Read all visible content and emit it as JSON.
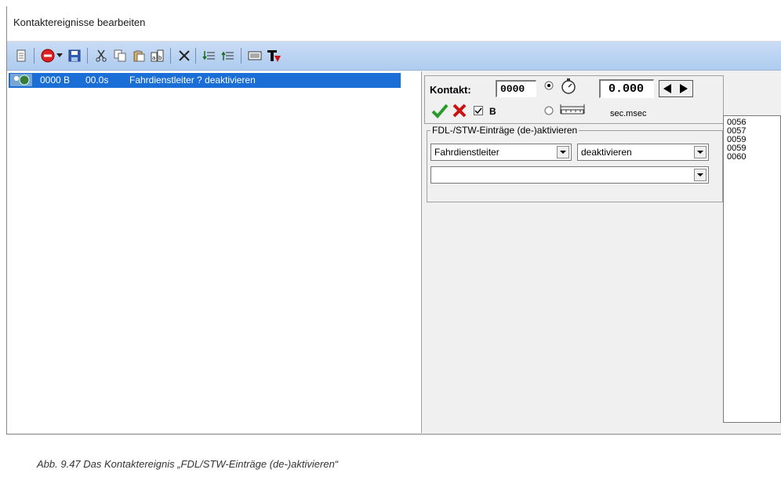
{
  "window": {
    "title": "Kontaktereignisse bearbeiten"
  },
  "toolbar": {
    "icons": [
      "new-document-icon",
      "record-icon",
      "dropdown-arrow-icon",
      "save-icon",
      "cut-icon",
      "copy-icon",
      "paste-icon",
      "paste-special-icon",
      "delete-icon",
      "move-down-icon",
      "move-up-icon",
      "list-view-icon",
      "text-tool-icon"
    ]
  },
  "events": [
    {
      "icon": "contact-event-icon",
      "contact": "0000 B",
      "time": "00.0s",
      "description": "Fahrdienstleiter ? deaktivieren"
    }
  ],
  "contact_panel": {
    "label": "Kontakt:",
    "contact_value": "0000",
    "b_label": "B",
    "b_checked": true,
    "time_value": "0.000",
    "unit_label": "sec.msec"
  },
  "group": {
    "title": "FDL-/STW-Einträge (de-)aktivieren",
    "type_select": "Fahrdienstleiter",
    "action_select": "deaktivieren",
    "third_select": ""
  },
  "number_list": [
    "0056",
    "0057",
    "0059",
    "0059",
    "0060"
  ],
  "caption": "Abb. 9.47    Das Kontaktereignis „FDL/STW-Einträge (de-)aktivieren“",
  "colors": {
    "selection": "#1b6ed6",
    "toolbar": "#b9d2f2",
    "accent_red": "#cc1111",
    "accent_green": "#2a9a2a"
  }
}
